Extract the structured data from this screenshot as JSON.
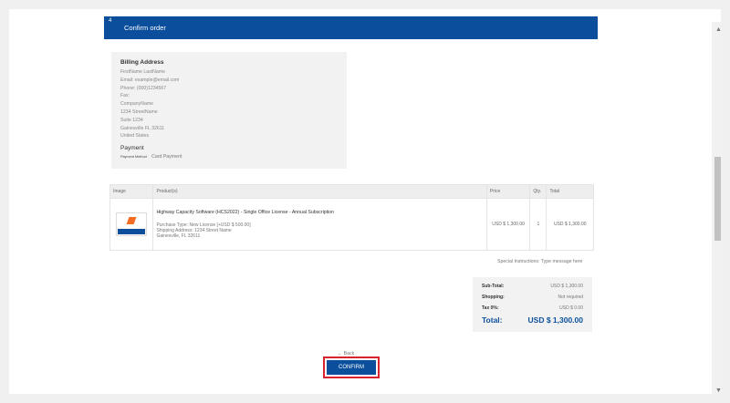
{
  "step": {
    "number": "4",
    "title": "Confirm order"
  },
  "billing": {
    "heading": "Billing Address",
    "lines": [
      "FirstName LastName",
      "Email: example@email.com",
      "Phone: (000)1234567",
      "Fax:",
      "CompanyName",
      "1234 StreetName",
      "Suite 1234",
      "Gainesville FL 32611",
      "United States"
    ]
  },
  "payment": {
    "heading": "Payment",
    "method_label": "Payment Method",
    "method_value": "Card Payment"
  },
  "table": {
    "headers": {
      "image": "Image",
      "product": "Product(s)",
      "price": "Price",
      "qty": "Qty.",
      "total": "Total"
    },
    "row": {
      "name": "Highway Capacity Software (HCS2022) - Single Office License - Annual Subscription",
      "details": [
        "Purchase Type: New License [+USD $ 500.00]",
        "Shipping Address: 1234 Street Name",
        "Gainesville, FL 32611"
      ],
      "price": "USD $ 1,300.00",
      "qty": "1",
      "total": "USD $ 1,300.00"
    }
  },
  "special_instructions": "Special Instructions: Type message here",
  "totals": {
    "subtotal_label": "Sub-Total:",
    "subtotal_value": "USD $ 1,300.00",
    "shopping_label": "Shopping:",
    "shopping_value": "Not required",
    "tax_label": "Tax 0%:",
    "tax_value": "USD $ 0.00",
    "total_label": "Total:",
    "total_value": "USD $ 1,300.00"
  },
  "back_label": "← Back",
  "confirm_label": "CONFIRM",
  "colors": {
    "brand": "#0b4f9c",
    "accent_outline": "#d9232d",
    "logo_orange": "#f36c21"
  }
}
